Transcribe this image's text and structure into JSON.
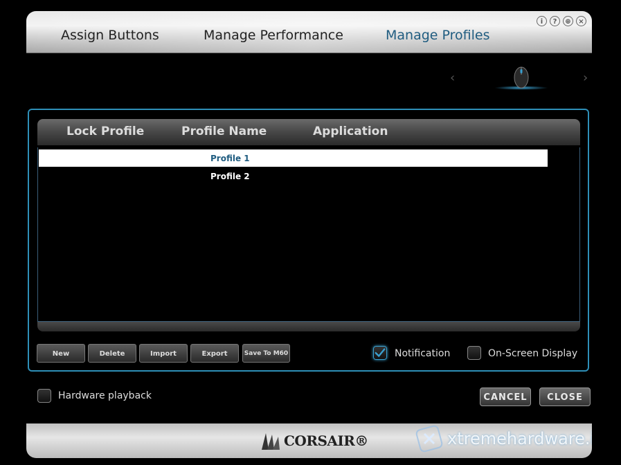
{
  "tabs": [
    {
      "label": "Assign Buttons",
      "active": false
    },
    {
      "label": "Manage Performance",
      "active": false
    },
    {
      "label": "Manage Profiles",
      "active": true
    }
  ],
  "window_icons": [
    "info-icon",
    "help-icon",
    "globe-icon",
    "close-icon"
  ],
  "table": {
    "columns": [
      "Lock Profile",
      "Profile Name",
      "Application"
    ],
    "rows": [
      {
        "profile_name": "Profile 1",
        "selected": true
      },
      {
        "profile_name": "Profile 2",
        "selected": false
      }
    ]
  },
  "buttons": {
    "new": "New",
    "delete": "Delete",
    "import": "Import",
    "export": "Export",
    "save_to": "Save To M60"
  },
  "options": {
    "notification": {
      "label": "Notification",
      "checked": true
    },
    "osd": {
      "label": "On-Screen Display",
      "checked": false
    },
    "hardware_playback": {
      "label": "Hardware playback",
      "checked": false
    }
  },
  "actions": {
    "cancel": "CANCEL",
    "close": "CLOSE"
  },
  "brand": {
    "logo": "CORSAIR®"
  },
  "watermark": {
    "text": "xtremehardware.it"
  },
  "colors": {
    "accent": "#2e8fb8",
    "active_tab": "#1f5c80"
  }
}
